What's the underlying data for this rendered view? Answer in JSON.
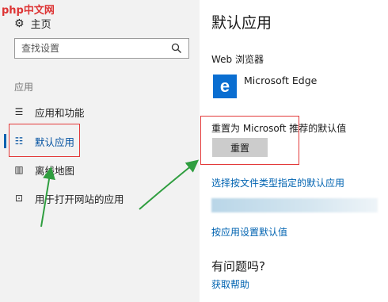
{
  "watermark": "php中文网",
  "sidebar": {
    "home_label": "主页",
    "search_placeholder": "查找设置",
    "section_label": "应用",
    "items": [
      {
        "label": "应用和功能",
        "icon": "list-icon",
        "active": false
      },
      {
        "label": "默认应用",
        "icon": "default-apps-icon",
        "active": true
      },
      {
        "label": "离线地图",
        "icon": "map-icon",
        "active": false
      },
      {
        "label": "用于打开网站的应用",
        "icon": "open-web-icon",
        "active": false
      }
    ]
  },
  "main": {
    "title": "默认应用",
    "web_browser_label": "Web 浏览器",
    "browser_name": "Microsoft Edge",
    "browser_icon": "e",
    "reset_label": "重置为 Microsoft 推荐的默认值",
    "reset_button": "重置",
    "link_filetype": "选择按文件类型指定的默认应用",
    "link_app": "按应用设置默认值",
    "question": "有问题吗?",
    "help_link": "获取帮助"
  },
  "colors": {
    "accent": "#0063b1",
    "annotation_red": "#e33a3a",
    "annotation_green": "#2f9e3f",
    "edge": "#0a6ed1"
  }
}
